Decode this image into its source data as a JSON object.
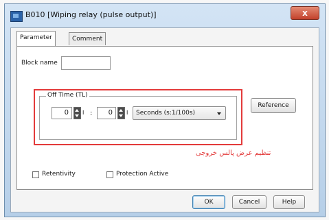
{
  "window": {
    "title": "B010 [Wiping relay (pulse output)]",
    "close_glyph": "x"
  },
  "tabs": [
    {
      "label": "Parameter"
    },
    {
      "label": "Comment"
    }
  ],
  "block_name": {
    "label": "Block name",
    "value": ""
  },
  "off_time": {
    "label": "Off Time (TL)",
    "value1": "0",
    "unit1": "I",
    "separator": ":",
    "value2": "0",
    "unit2": "I",
    "timebase": "Seconds (s:1/100s)"
  },
  "reference_button": "Reference",
  "annotation": "تنظیم عرض پالس خروجی",
  "checkboxes": [
    {
      "label": "Retentivity",
      "checked": false
    },
    {
      "label": "Protection Active",
      "checked": false
    }
  ],
  "buttons": {
    "ok": "OK",
    "cancel": "Cancel",
    "help": "Help"
  },
  "colors": {
    "highlight": "#e33a3a",
    "title_bg": "#c8dcf1"
  }
}
